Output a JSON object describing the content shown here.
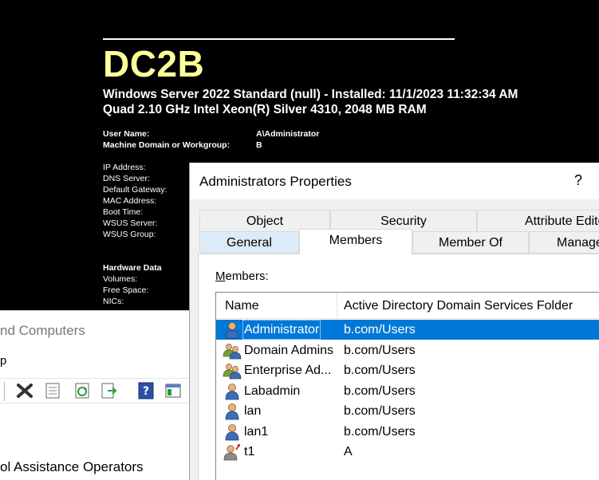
{
  "bginfo": {
    "hostname": "DC2B",
    "os_line": "Windows Server 2022 Standard (null) - Installed: 11/1/2023 11:32:34 AM",
    "cpu_line": "Quad 2.10 GHz Intel Xeon(R) Silver 4310,  2048 MB RAM",
    "user_name_label": "User Name:",
    "user_name_value": "A\\Administrator",
    "domain_label": "Machine Domain or Workgroup:",
    "domain_value": "B",
    "ip_label": "IP Address:",
    "dns_label": "DNS Server:",
    "gateway_label": "Default Gateway:",
    "mac_label": "MAC Address:",
    "boot_label": "Boot Time:",
    "wsus_server_label": "WSUS Server:",
    "wsus_group_label": "WSUS Group:",
    "hardware_heading": "Hardware Data",
    "volumes_label": "Volumes:",
    "free_space_label": "Free Space:",
    "nics_label": "NICs:",
    "host_color": "#ffff99"
  },
  "aduc": {
    "title_fragment": "nd Computers",
    "menu_fragment": "p",
    "list_item_fragment": "ol Assistance Operators"
  },
  "dialog": {
    "title": "Administrators Properties",
    "help": "?",
    "tabs_row1": [
      "Object",
      "Security",
      "Attribute Edito"
    ],
    "tabs_row2": [
      "General",
      "Members",
      "Member Of",
      "Manage"
    ],
    "members_label_accel": "M",
    "members_label_rest": "embers:",
    "columns": [
      "Name",
      "Active Directory Domain Services Folder"
    ],
    "members": [
      {
        "name": "Administrator",
        "folder": "b.com/Users",
        "icon": "user-icon",
        "selected": true
      },
      {
        "name": "Domain Admins",
        "folder": "b.com/Users",
        "icon": "group-icon",
        "selected": false
      },
      {
        "name": "Enterprise Ad...",
        "folder": "b.com/Users",
        "icon": "group-icon",
        "selected": false
      },
      {
        "name": "Labadmin",
        "folder": "b.com/Users",
        "icon": "user-icon",
        "selected": false
      },
      {
        "name": "lan",
        "folder": "b.com/Users",
        "icon": "user-icon",
        "selected": false
      },
      {
        "name": "lan1",
        "folder": "b.com/Users",
        "icon": "user-icon",
        "selected": false
      },
      {
        "name": "t1",
        "folder": "A",
        "icon": "foreign-user-icon",
        "selected": false
      }
    ],
    "selection_color": "#0078d7"
  }
}
